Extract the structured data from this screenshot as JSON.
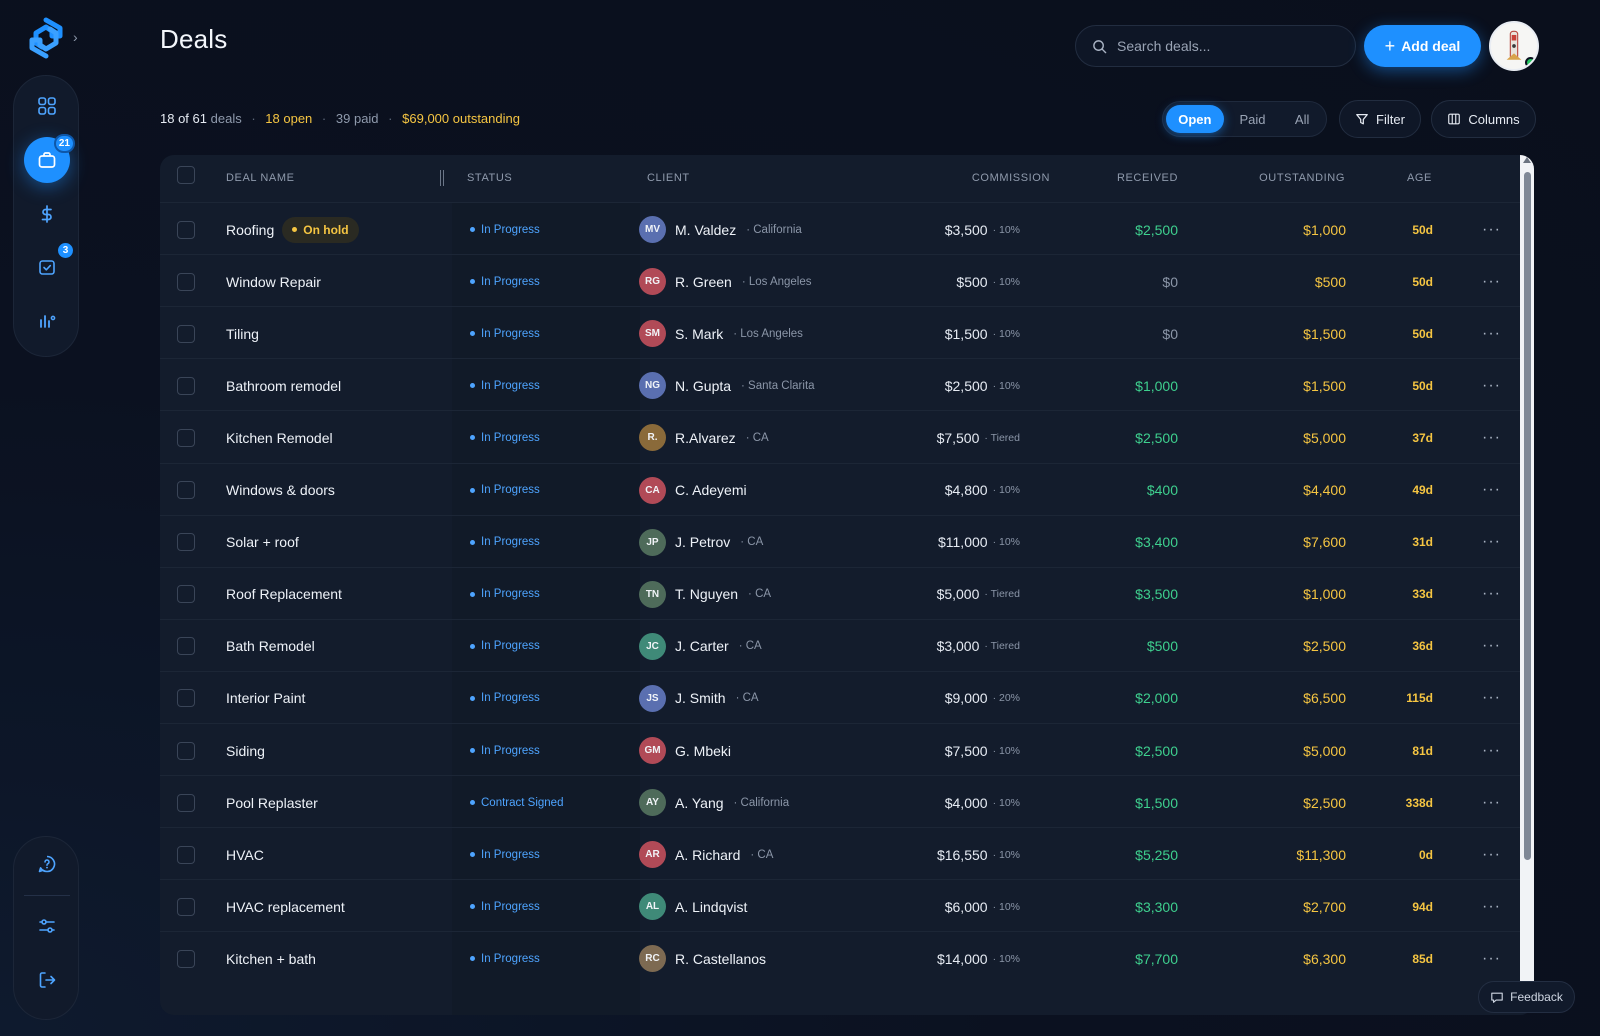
{
  "app": {
    "title": "Deals"
  },
  "sidebar": {
    "nav": [
      {
        "icon": "dashboard-grid-icon",
        "badge": null
      },
      {
        "icon": "briefcase-icon",
        "badge": "21",
        "active": true
      },
      {
        "icon": "dollar-icon",
        "badge": null
      },
      {
        "icon": "task-check-icon",
        "badge": "3"
      },
      {
        "icon": "analytics-icon",
        "badge": null
      }
    ],
    "bottom": [
      {
        "icon": "help-chat-icon"
      },
      {
        "icon": "settings-sliders-icon"
      },
      {
        "icon": "logout-icon"
      }
    ]
  },
  "header": {
    "search_placeholder": "Search deals...",
    "add_label": "Add deal"
  },
  "summary": {
    "count": "18 of 61",
    "count_suffix": "deals",
    "open": "18 open",
    "paid": "39 paid",
    "outstanding": "$69,000 outstanding"
  },
  "filters": {
    "tabs": [
      "Open",
      "Paid",
      "All"
    ],
    "filter_label": "Filter",
    "columns_label": "Columns"
  },
  "table": {
    "headers": {
      "name": "DEAL NAME",
      "status": "STATUS",
      "client": "CLIENT",
      "commission": "COMMISSION",
      "received": "RECEIVED",
      "outstanding": "OUTSTANDING",
      "age": "AGE"
    },
    "rows": [
      {
        "name": "Roofing",
        "tag": "On hold",
        "status": "In Progress",
        "initials": "MV",
        "av_color": "#5a6fb0",
        "client": "M. Valdez",
        "loc": "· California",
        "commission": "$3,500",
        "rate": "· 10%",
        "received": "$2,500",
        "received_tone": "green",
        "outstanding": "$1,000",
        "age": "50d"
      },
      {
        "name": "Window Repair",
        "tag": "",
        "status": "In Progress",
        "initials": "RG",
        "av_color": "#b14a57",
        "client": "R. Green",
        "loc": "· Los Angeles",
        "commission": "$500",
        "rate": "· 10%",
        "received": "$0",
        "received_tone": "grey",
        "outstanding": "$500",
        "age": "50d"
      },
      {
        "name": "Tiling",
        "tag": "",
        "status": "In Progress",
        "initials": "SM",
        "av_color": "#b14a57",
        "client": "S. Mark",
        "loc": "· Los Angeles",
        "commission": "$1,500",
        "rate": "· 10%",
        "received": "$0",
        "received_tone": "grey",
        "outstanding": "$1,500",
        "age": "50d"
      },
      {
        "name": "Bathroom remodel",
        "tag": "",
        "status": "In Progress",
        "initials": "NG",
        "av_color": "#5a6fb0",
        "client": "N. Gupta",
        "loc": "· Santa Clarita",
        "commission": "$2,500",
        "rate": "· 10%",
        "received": "$1,000",
        "received_tone": "green",
        "outstanding": "$1,500",
        "age": "50d"
      },
      {
        "name": "Kitchen Remodel",
        "tag": "",
        "status": "In Progress",
        "initials": "R.",
        "av_color": "#8a6a3a",
        "client": "R.Alvarez",
        "loc": "· CA",
        "commission": "$7,500",
        "rate": "· Tiered",
        "received": "$2,500",
        "received_tone": "green",
        "outstanding": "$5,000",
        "age": "37d"
      },
      {
        "name": "Windows & doors",
        "tag": "",
        "status": "In Progress",
        "initials": "CA",
        "av_color": "#b14a57",
        "client": "C. Adeyemi",
        "loc": "",
        "commission": "$4,800",
        "rate": "· 10%",
        "received": "$400",
        "received_tone": "green",
        "outstanding": "$4,400",
        "age": "49d"
      },
      {
        "name": "Solar + roof",
        "tag": "",
        "status": "In Progress",
        "initials": "JP",
        "av_color": "#4e6b5a",
        "client": "J. Petrov",
        "loc": "· CA",
        "commission": "$11,000",
        "rate": "· 10%",
        "received": "$3,400",
        "received_tone": "green",
        "outstanding": "$7,600",
        "age": "31d"
      },
      {
        "name": "Roof Replacement",
        "tag": "",
        "status": "In Progress",
        "initials": "TN",
        "av_color": "#4e6b5a",
        "client": "T. Nguyen",
        "loc": "· CA",
        "commission": "$5,000",
        "rate": "· Tiered",
        "received": "$3,500",
        "received_tone": "green",
        "outstanding": "$1,000",
        "age": "33d"
      },
      {
        "name": "Bath Remodel",
        "tag": "",
        "status": "In Progress",
        "initials": "JC",
        "av_color": "#3f8a78",
        "client": "J. Carter",
        "loc": "· CA",
        "commission": "$3,000",
        "rate": "· Tiered",
        "received": "$500",
        "received_tone": "green",
        "outstanding": "$2,500",
        "age": "36d"
      },
      {
        "name": "Interior Paint",
        "tag": "",
        "status": "In Progress",
        "initials": "JS",
        "av_color": "#5a6fb0",
        "client": "J. Smith",
        "loc": "· CA",
        "commission": "$9,000",
        "rate": "· 20%",
        "received": "$2,000",
        "received_tone": "green",
        "outstanding": "$6,500",
        "age": "115d"
      },
      {
        "name": "Siding",
        "tag": "",
        "status": "In Progress",
        "initials": "GM",
        "av_color": "#b14a57",
        "client": "G. Mbeki",
        "loc": "",
        "commission": "$7,500",
        "rate": "· 10%",
        "received": "$2,500",
        "received_tone": "green",
        "outstanding": "$5,000",
        "age": "81d"
      },
      {
        "name": "Pool Replaster",
        "tag": "",
        "status": "Contract Signed",
        "initials": "AY",
        "av_color": "#4e6b5a",
        "client": "A. Yang",
        "loc": "· California",
        "commission": "$4,000",
        "rate": "· 10%",
        "received": "$1,500",
        "received_tone": "green",
        "outstanding": "$2,500",
        "age": "338d"
      },
      {
        "name": "HVAC",
        "tag": "",
        "status": "In Progress",
        "initials": "AR",
        "av_color": "#b14a57",
        "client": "A. Richard",
        "loc": "· CA",
        "commission": "$16,550",
        "rate": "· 10%",
        "received": "$5,250",
        "received_tone": "green",
        "outstanding": "$11,300",
        "age": "0d"
      },
      {
        "name": "HVAC replacement",
        "tag": "",
        "status": "In Progress",
        "initials": "AL",
        "av_color": "#3f8a78",
        "client": "A. Lindqvist",
        "loc": "",
        "commission": "$6,000",
        "rate": "· 10%",
        "received": "$3,300",
        "received_tone": "green",
        "outstanding": "$2,700",
        "age": "94d"
      },
      {
        "name": "Kitchen + bath",
        "tag": "",
        "status": "In Progress",
        "initials": "RC",
        "av_color": "#7d6a52",
        "client": "R. Castellanos",
        "loc": "",
        "commission": "$14,000",
        "rate": "· 10%",
        "received": "$7,700",
        "received_tone": "green",
        "outstanding": "$6,300",
        "age": "85d"
      }
    ]
  },
  "feedback": {
    "label": "Feedback"
  }
}
